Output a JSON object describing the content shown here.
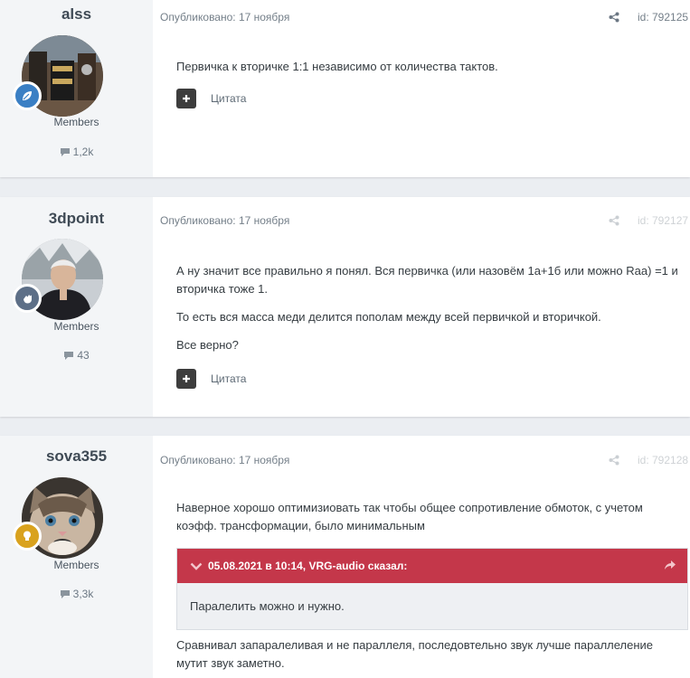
{
  "posts": [
    {
      "author": "alss",
      "group": "Members",
      "post_count": "1,2k",
      "published": "Опубликовано: 17 ноября",
      "id": "id: 792125",
      "paragraphs": [
        "Первичка к вторичке 1:1 независимо от количества тактов."
      ],
      "quote_label": "Цитата",
      "badge_color": "#3a7fc4",
      "badge_icon": "leaf-icon"
    },
    {
      "author": "3dpoint",
      "group": "Members",
      "post_count": "43",
      "published": "Опубликовано: 17 ноября",
      "id": "id: 792127",
      "paragraphs": [
        "А ну значит все правильно я понял.  Вся первичка (или назовём 1а+1б или можно Raa) =1 и вторичка тоже 1.",
        "То есть вся масса меди делится пополам между всей первичкой и вторичкой.",
        "Все верно?"
      ],
      "quote_label": "Цитата",
      "badge_color": "#5d6f87",
      "badge_icon": "hand-icon"
    },
    {
      "author": "sova355",
      "group": "Members",
      "post_count": "3,3k",
      "published": "Опубликовано: 17 ноября",
      "id": "id: 792128",
      "paragraphs": [
        "Наверное хорошо оптимизиовать  так чтобы общее сопротивление обмоток, с учетом коэфф. трансформации,  было минимальным"
      ],
      "quote": {
        "header": "05.08.2021 в 10:14, VRG-audio сказал:",
        "body": "Паралелить можно и нужно."
      },
      "after_quote": "Сравнивал запаралеливая и не параллеля, последовтельно звук лучше параллеление мутит звук заметно.",
      "badge_color": "#d9a21e",
      "badge_icon": "lightbulb-icon"
    }
  ]
}
